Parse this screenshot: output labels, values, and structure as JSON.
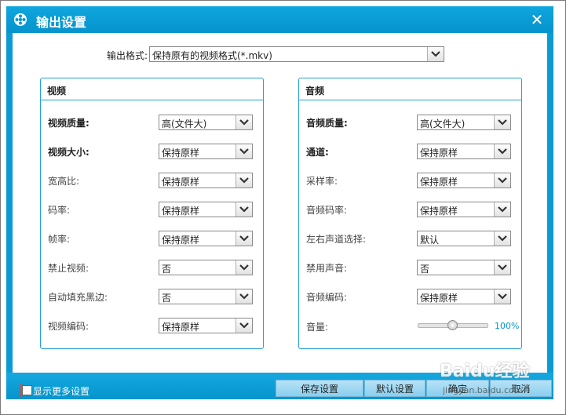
{
  "window": {
    "title": "输出设置",
    "close_glyph": "✕"
  },
  "format": {
    "label": "输出格式:",
    "value": "保持原有的视频格式(*.mkv)"
  },
  "video": {
    "title": "视频",
    "rows": [
      {
        "label": "视频质量:",
        "value": "高(文件大)",
        "bold": true
      },
      {
        "label": "视频大小:",
        "value": "保持原样",
        "bold": true
      },
      {
        "label": "宽高比:",
        "value": "保持原样"
      },
      {
        "label": "码率:",
        "value": "保持原样"
      },
      {
        "label": "帧率:",
        "value": "保持原样"
      },
      {
        "label": "禁止视频:",
        "value": "否"
      },
      {
        "label": "自动填充黑边:",
        "value": "否"
      },
      {
        "label": "视频编码:",
        "value": "保持原样"
      }
    ]
  },
  "audio": {
    "title": "音频",
    "rows": [
      {
        "label": "音频质量:",
        "value": "高(文件大)",
        "bold": true
      },
      {
        "label": "通道:",
        "value": "保持原样",
        "bold": true
      },
      {
        "label": "采样率:",
        "value": "保持原样"
      },
      {
        "label": "音频码率:",
        "value": "保持原样"
      },
      {
        "label": "左右声道选择:",
        "value": "默认"
      },
      {
        "label": "禁用声音:",
        "value": "否"
      },
      {
        "label": "音频编码:",
        "value": "保持原样"
      }
    ],
    "volume_label": "音量:",
    "volume_value": "100%",
    "volume_level": 0.5
  },
  "footer": {
    "more_settings": "显示更多设置",
    "save": "保存设置",
    "default": "默认设置",
    "ok": "确定",
    "cancel": "取消"
  },
  "watermark": {
    "text": "Baidu经验",
    "sub": "jingyan.baidu.com"
  },
  "colors": {
    "accent": "#0a9ad2",
    "group_border": "#23a2d4",
    "button": "#9fd8f2"
  }
}
